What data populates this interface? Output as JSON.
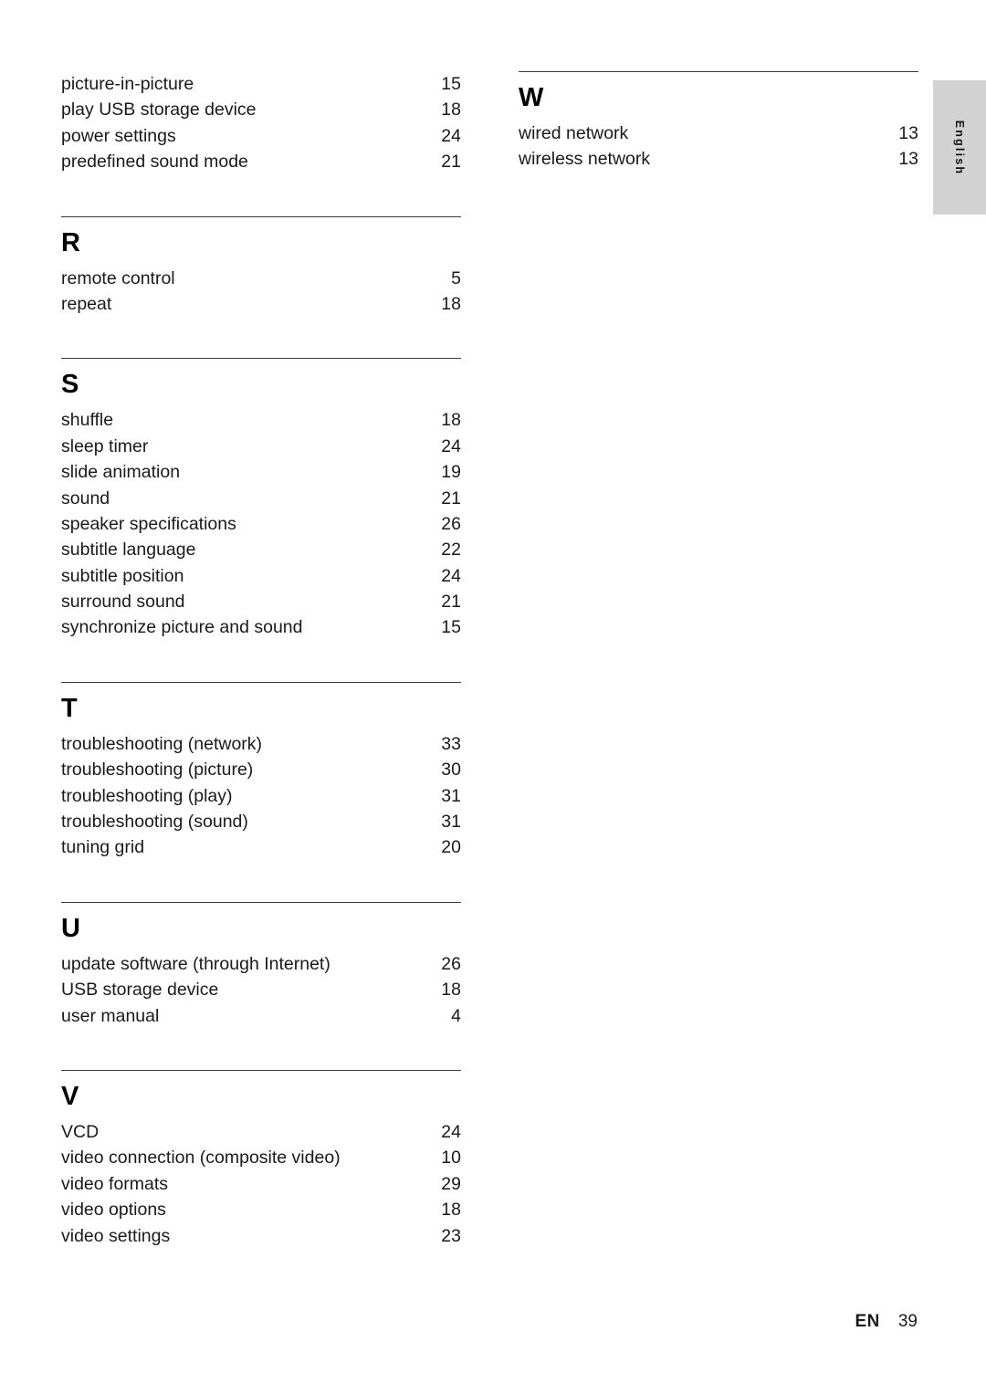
{
  "document": {
    "language_tab": "English",
    "footer": {
      "locale_code": "EN",
      "page_number": "39"
    }
  },
  "index": {
    "columns": [
      {
        "name": "left-column",
        "blocks": [
          {
            "letter": "",
            "entries": [
              {
                "label": "picture-in-picture",
                "page": "15"
              },
              {
                "label": "play USB storage device",
                "page": "18"
              },
              {
                "label": "power settings",
                "page": "24"
              },
              {
                "label": "predefined sound mode",
                "page": "21"
              }
            ]
          },
          {
            "letter": "R",
            "entries": [
              {
                "label": "remote control",
                "page": "5"
              },
              {
                "label": "repeat",
                "page": "18"
              }
            ]
          },
          {
            "letter": "S",
            "entries": [
              {
                "label": "shuffle",
                "page": "18"
              },
              {
                "label": "sleep timer",
                "page": "24"
              },
              {
                "label": "slide animation",
                "page": "19"
              },
              {
                "label": "sound",
                "page": "21"
              },
              {
                "label": "speaker specifications",
                "page": "26"
              },
              {
                "label": "subtitle language",
                "page": "22"
              },
              {
                "label": "subtitle position",
                "page": "24"
              },
              {
                "label": "surround sound",
                "page": "21"
              },
              {
                "label": "synchronize picture and sound",
                "page": "15"
              }
            ]
          },
          {
            "letter": "T",
            "entries": [
              {
                "label": "troubleshooting (network)",
                "page": "33"
              },
              {
                "label": "troubleshooting (picture)",
                "page": "30"
              },
              {
                "label": "troubleshooting (play)",
                "page": "31"
              },
              {
                "label": "troubleshooting (sound)",
                "page": "31"
              },
              {
                "label": "tuning grid",
                "page": "20"
              }
            ]
          },
          {
            "letter": "U",
            "entries": [
              {
                "label": "update software (through Internet)",
                "page": "26"
              },
              {
                "label": "USB storage device",
                "page": "18"
              },
              {
                "label": "user manual",
                "page": "4"
              }
            ]
          },
          {
            "letter": "V",
            "entries": [
              {
                "label": "VCD",
                "page": "24"
              },
              {
                "label": "video connection (composite video)",
                "page": "10"
              },
              {
                "label": "video formats",
                "page": "29"
              },
              {
                "label": "video options",
                "page": "18"
              },
              {
                "label": "video settings",
                "page": "23"
              }
            ]
          }
        ]
      },
      {
        "name": "right-column",
        "blocks": [
          {
            "letter": "W",
            "entries": [
              {
                "label": "wired network",
                "page": "13"
              },
              {
                "label": "wireless network",
                "page": "13"
              }
            ]
          }
        ]
      }
    ]
  }
}
